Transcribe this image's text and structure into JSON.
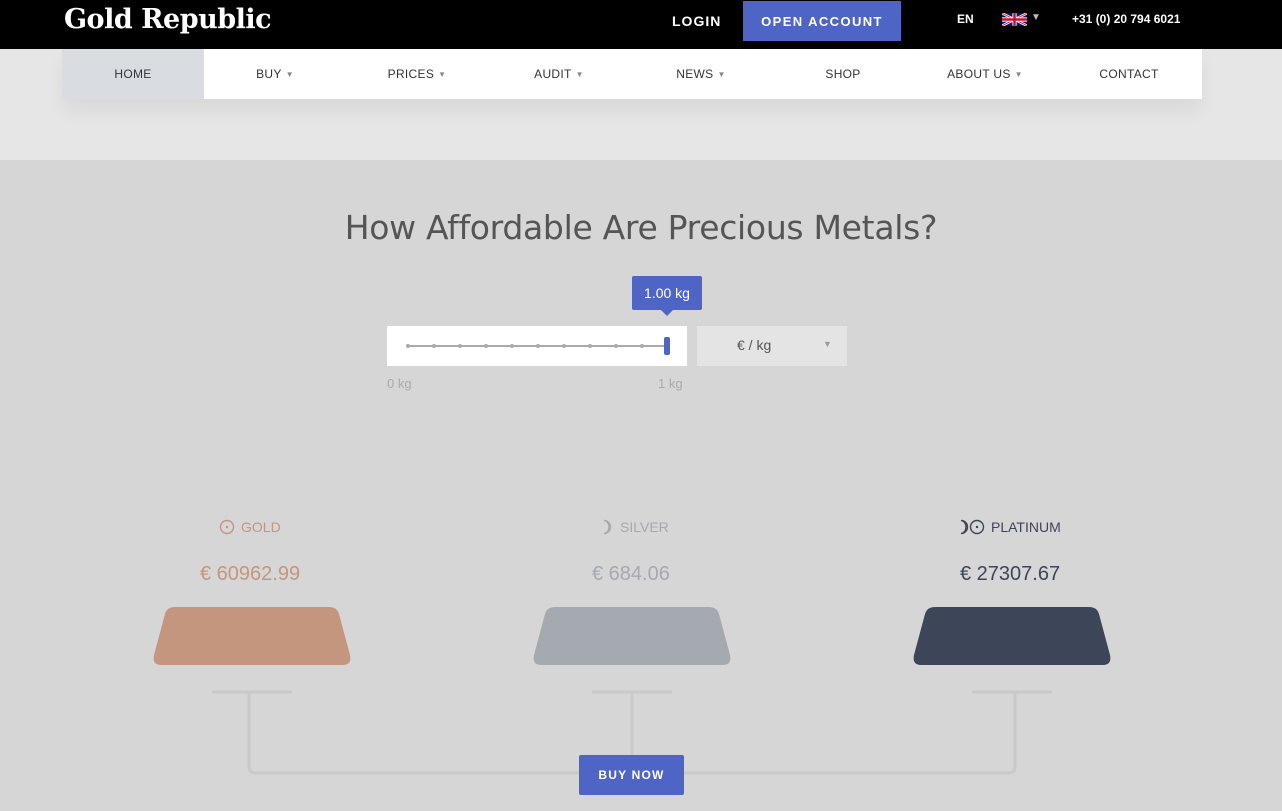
{
  "header": {
    "logo": "Gold Republic",
    "login": "LOGIN",
    "open_account": "OPEN ACCOUNT",
    "language": "EN",
    "phone": "+31 (0) 20 794 6021"
  },
  "nav": {
    "items": [
      {
        "label": "HOME",
        "has_dropdown": false,
        "active": true
      },
      {
        "label": "BUY",
        "has_dropdown": true
      },
      {
        "label": "PRICES",
        "has_dropdown": true
      },
      {
        "label": "AUDIT",
        "has_dropdown": true
      },
      {
        "label": "NEWS",
        "has_dropdown": true
      },
      {
        "label": "SHOP",
        "has_dropdown": false
      },
      {
        "label": "ABOUT US",
        "has_dropdown": true
      },
      {
        "label": "CONTACT",
        "has_dropdown": false
      }
    ]
  },
  "main": {
    "headline": "How Affordable Are Precious Metals?",
    "slider": {
      "tooltip": "1.00 kg",
      "min_label": "0 kg",
      "max_label": "1 kg",
      "value_fraction": 1.0
    },
    "unit_select": {
      "selected": "€ / kg"
    },
    "metals": [
      {
        "name": "GOLD",
        "price": "€ 60962.99",
        "icon": "gold-symbol-icon",
        "color": "#c4967d"
      },
      {
        "name": "SILVER",
        "price": "€ 684.06",
        "icon": "silver-symbol-icon",
        "color": "#a5a9b0"
      },
      {
        "name": "PLATINUM",
        "price": "€ 27307.67",
        "icon": "platinum-symbol-icon",
        "color": "#3d4559"
      }
    ],
    "buy_now": "BUY NOW"
  },
  "colors": {
    "accent": "#4f65c5",
    "gold": "#c4967d",
    "silver": "#a5a9b0",
    "platinum": "#3d4559"
  }
}
